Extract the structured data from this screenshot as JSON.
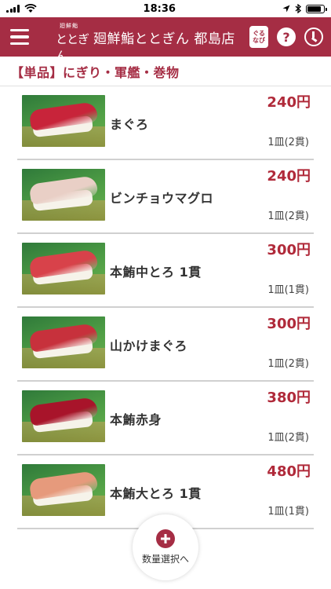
{
  "status_bar": {
    "time": "18:36",
    "battery_level": 0.85
  },
  "header": {
    "logo_small": "廻鮮鮨",
    "logo_big": "ととぎん",
    "store_name": "廻鮮鮨ととぎん 都島店",
    "gnavi_label_1": "ぐる",
    "gnavi_label_2": "なび",
    "help_label": "?",
    "accent": "#a52d44"
  },
  "section": {
    "title": "【単品】にぎり・軍艦・巻物"
  },
  "menu_items": [
    {
      "name": "まぐろ",
      "price": "240円",
      "qty": "1皿(2貫)",
      "fish_color": "#c8243a"
    },
    {
      "name": "ビンチョウマグロ",
      "price": "240円",
      "qty": "1皿(2貫)",
      "fish_color": "#e9cfc6"
    },
    {
      "name": "本鮪中とろ 1貫",
      "price": "300円",
      "qty": "1皿(1貫)",
      "fish_color": "#d8424a"
    },
    {
      "name": "山かけまぐろ",
      "price": "300円",
      "qty": "1皿(2貫)",
      "fish_color": "#c7313c"
    },
    {
      "name": "本鮪赤身",
      "price": "380円",
      "qty": "1皿(2貫)",
      "fish_color": "#a8142a"
    },
    {
      "name": "本鮪大とろ 1貫",
      "price": "480円",
      "qty": "1皿(1貫)",
      "fish_color": "#e69a7c"
    }
  ],
  "fab": {
    "label": "数量選択へ"
  }
}
